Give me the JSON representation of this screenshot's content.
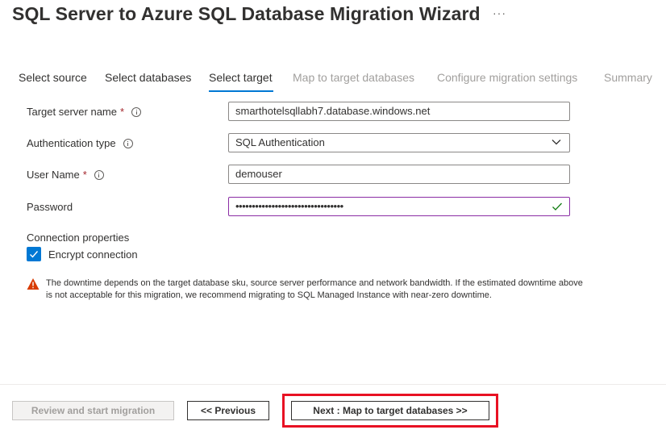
{
  "header": {
    "title": "SQL Server to Azure SQL Database Migration Wizard",
    "more_label": "···"
  },
  "tabs": [
    {
      "label": "Select source",
      "state": "done"
    },
    {
      "label": "Select databases",
      "state": "done"
    },
    {
      "label": "Select target",
      "state": "active"
    },
    {
      "label": "Map to target databases",
      "state": "disabled"
    },
    {
      "label": "Configure migration settings",
      "state": "disabled"
    },
    {
      "label": "Summary",
      "state": "disabled"
    }
  ],
  "form": {
    "target_server": {
      "label": "Target server name",
      "required": "*",
      "value": "smarthotelsqllabh7.database.windows.net"
    },
    "auth_type": {
      "label": "Authentication type",
      "value": "SQL Authentication"
    },
    "user_name": {
      "label": "User Name",
      "required": "*",
      "value": "demouser"
    },
    "password": {
      "label": "Password",
      "value": "•••••••••••••••••••••••••••••••••"
    }
  },
  "connection": {
    "section_label": "Connection properties",
    "encrypt_label": "Encrypt connection",
    "encrypt_checked": true
  },
  "warning": {
    "text": "The downtime depends on the target database sku, source server performance and network bandwidth.  If the estimated downtime above is not acceptable for this migration, we recommend migrating to SQL Managed Instance with near-zero downtime."
  },
  "footer": {
    "review_label": "Review and start migration",
    "previous_label": "<< Previous",
    "next_label": "Next : Map to target databases >>"
  },
  "colors": {
    "accent": "#0078d4",
    "focus_border": "#8a2da5",
    "highlight": "#e81123",
    "warning": "#d83b01",
    "valid": "#107c10"
  }
}
